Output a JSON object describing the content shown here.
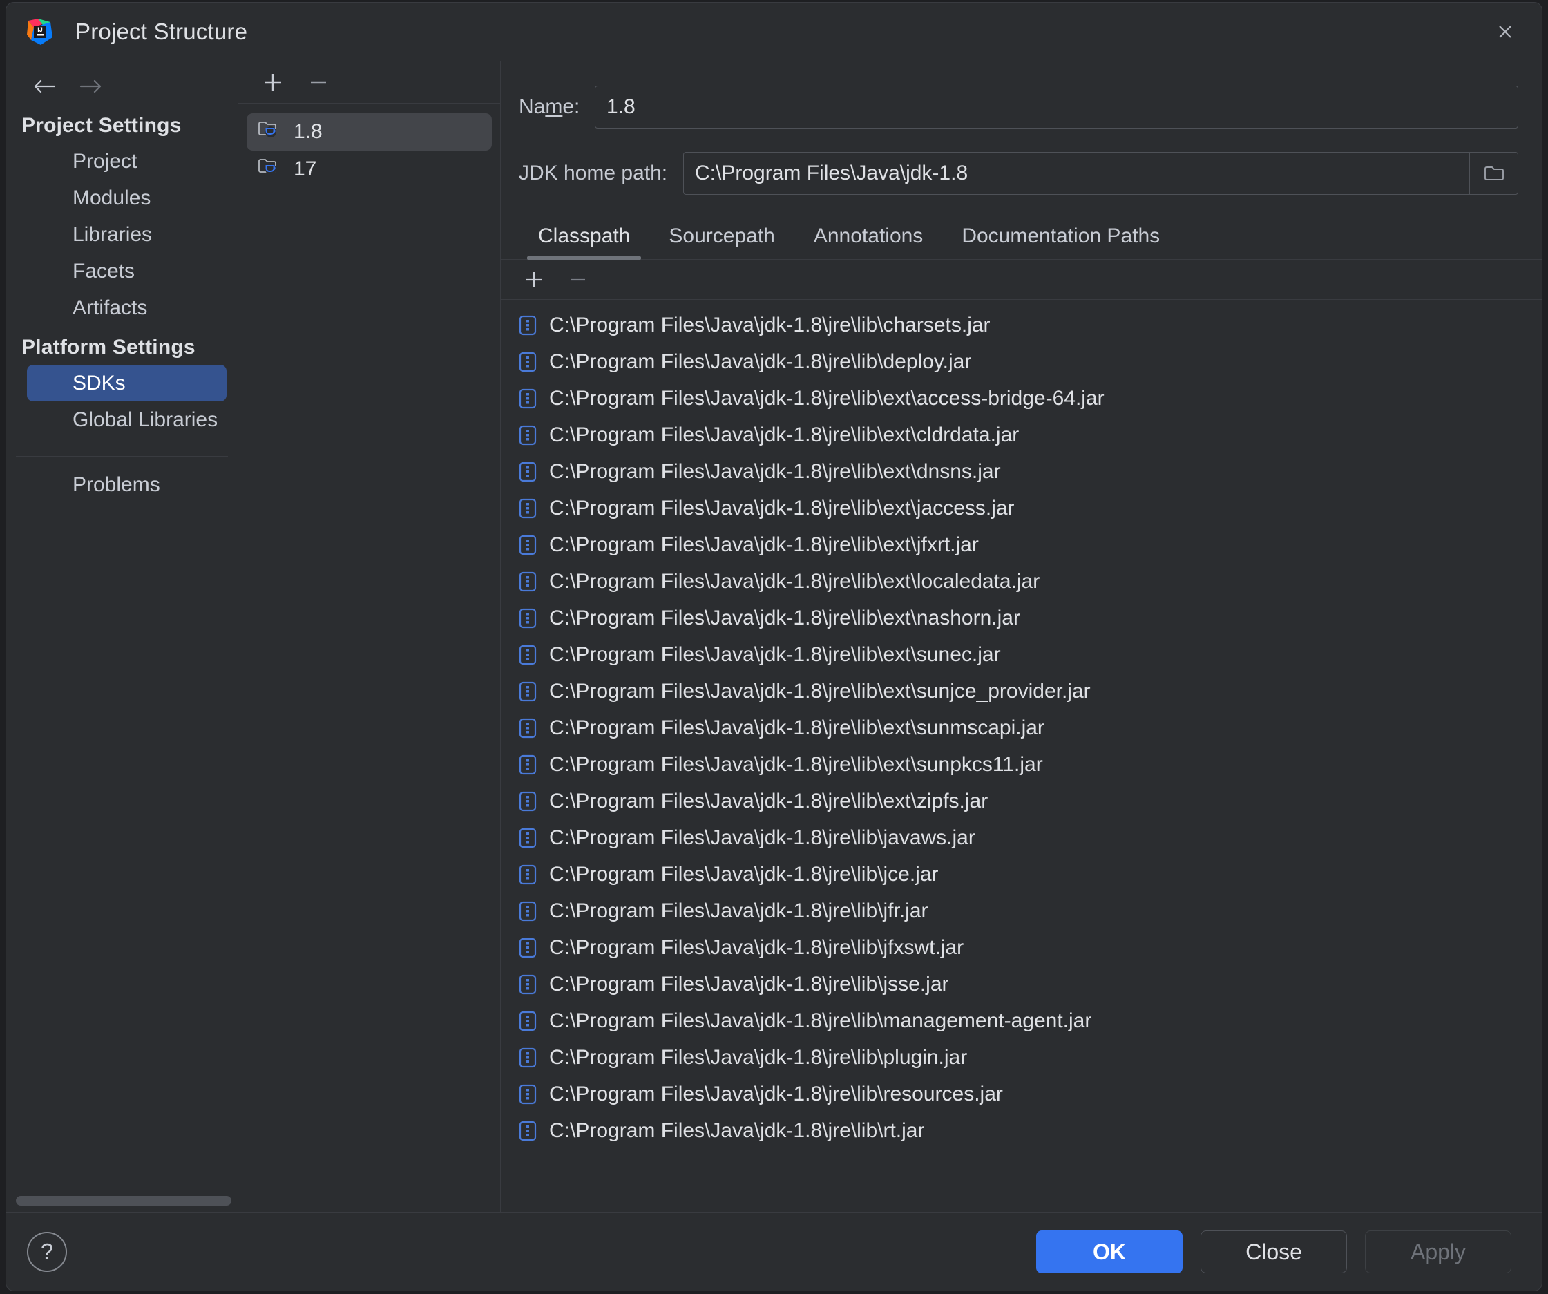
{
  "window": {
    "title": "Project Structure",
    "logo_icon": "intellij-idea-logo",
    "close_icon": "close-icon"
  },
  "sidebar": {
    "back_icon": "arrow-left-icon",
    "forward_icon": "arrow-right-icon",
    "sections": [
      {
        "heading": "Project Settings",
        "items": [
          {
            "label": "Project",
            "selected": false
          },
          {
            "label": "Modules",
            "selected": false
          },
          {
            "label": "Libraries",
            "selected": false
          },
          {
            "label": "Facets",
            "selected": false
          },
          {
            "label": "Artifacts",
            "selected": false
          }
        ]
      },
      {
        "heading": "Platform Settings",
        "items": [
          {
            "label": "SDKs",
            "selected": true
          },
          {
            "label": "Global Libraries",
            "selected": false
          }
        ]
      }
    ],
    "problems_label": "Problems"
  },
  "sdk_panel": {
    "add_icon": "plus-icon",
    "remove_icon": "minus-icon",
    "items": [
      {
        "label": "1.8",
        "icon": "jdk-folder-icon",
        "selected": true
      },
      {
        "label": "17",
        "icon": "jdk-folder-icon",
        "selected": false
      }
    ]
  },
  "detail": {
    "name_label_pre": "Na",
    "name_label_mnemonic": "m",
    "name_label_post": "e:",
    "name_value": "1.8",
    "home_label": "JDK home path:",
    "home_value": "C:\\Program Files\\Java\\jdk-1.8",
    "browse_icon": "folder-icon",
    "tabs": [
      {
        "label": "Classpath",
        "active": true
      },
      {
        "label": "Sourcepath",
        "active": false
      },
      {
        "label": "Annotations",
        "active": false
      },
      {
        "label": "Documentation Paths",
        "active": false
      }
    ],
    "toolbar": {
      "add_icon": "plus-icon",
      "remove_icon": "minus-icon"
    },
    "classpath_entries": [
      "C:\\Program Files\\Java\\jdk-1.8\\jre\\lib\\charsets.jar",
      "C:\\Program Files\\Java\\jdk-1.8\\jre\\lib\\deploy.jar",
      "C:\\Program Files\\Java\\jdk-1.8\\jre\\lib\\ext\\access-bridge-64.jar",
      "C:\\Program Files\\Java\\jdk-1.8\\jre\\lib\\ext\\cldrdata.jar",
      "C:\\Program Files\\Java\\jdk-1.8\\jre\\lib\\ext\\dnsns.jar",
      "C:\\Program Files\\Java\\jdk-1.8\\jre\\lib\\ext\\jaccess.jar",
      "C:\\Program Files\\Java\\jdk-1.8\\jre\\lib\\ext\\jfxrt.jar",
      "C:\\Program Files\\Java\\jdk-1.8\\jre\\lib\\ext\\localedata.jar",
      "C:\\Program Files\\Java\\jdk-1.8\\jre\\lib\\ext\\nashorn.jar",
      "C:\\Program Files\\Java\\jdk-1.8\\jre\\lib\\ext\\sunec.jar",
      "C:\\Program Files\\Java\\jdk-1.8\\jre\\lib\\ext\\sunjce_provider.jar",
      "C:\\Program Files\\Java\\jdk-1.8\\jre\\lib\\ext\\sunmscapi.jar",
      "C:\\Program Files\\Java\\jdk-1.8\\jre\\lib\\ext\\sunpkcs11.jar",
      "C:\\Program Files\\Java\\jdk-1.8\\jre\\lib\\ext\\zipfs.jar",
      "C:\\Program Files\\Java\\jdk-1.8\\jre\\lib\\javaws.jar",
      "C:\\Program Files\\Java\\jdk-1.8\\jre\\lib\\jce.jar",
      "C:\\Program Files\\Java\\jdk-1.8\\jre\\lib\\jfr.jar",
      "C:\\Program Files\\Java\\jdk-1.8\\jre\\lib\\jfxswt.jar",
      "C:\\Program Files\\Java\\jdk-1.8\\jre\\lib\\jsse.jar",
      "C:\\Program Files\\Java\\jdk-1.8\\jre\\lib\\management-agent.jar",
      "C:\\Program Files\\Java\\jdk-1.8\\jre\\lib\\plugin.jar",
      "C:\\Program Files\\Java\\jdk-1.8\\jre\\lib\\resources.jar",
      "C:\\Program Files\\Java\\jdk-1.8\\jre\\lib\\rt.jar"
    ],
    "entry_icon": "jar-archive-icon"
  },
  "footer": {
    "help_icon": "question-mark-icon",
    "help_glyph": "?",
    "buttons": [
      {
        "label": "OK",
        "style": "primary",
        "enabled": true
      },
      {
        "label": "Close",
        "style": "normal",
        "enabled": true
      },
      {
        "label": "Apply",
        "style": "disabled",
        "enabled": false
      }
    ]
  },
  "colors": {
    "accent": "#3574f0",
    "selection": "#35538f",
    "list_selection": "#43454a",
    "window_bg": "#2b2d30",
    "border": "#393b40",
    "text": "#dfe1e5",
    "jar_icon": "#4a7ad8"
  }
}
